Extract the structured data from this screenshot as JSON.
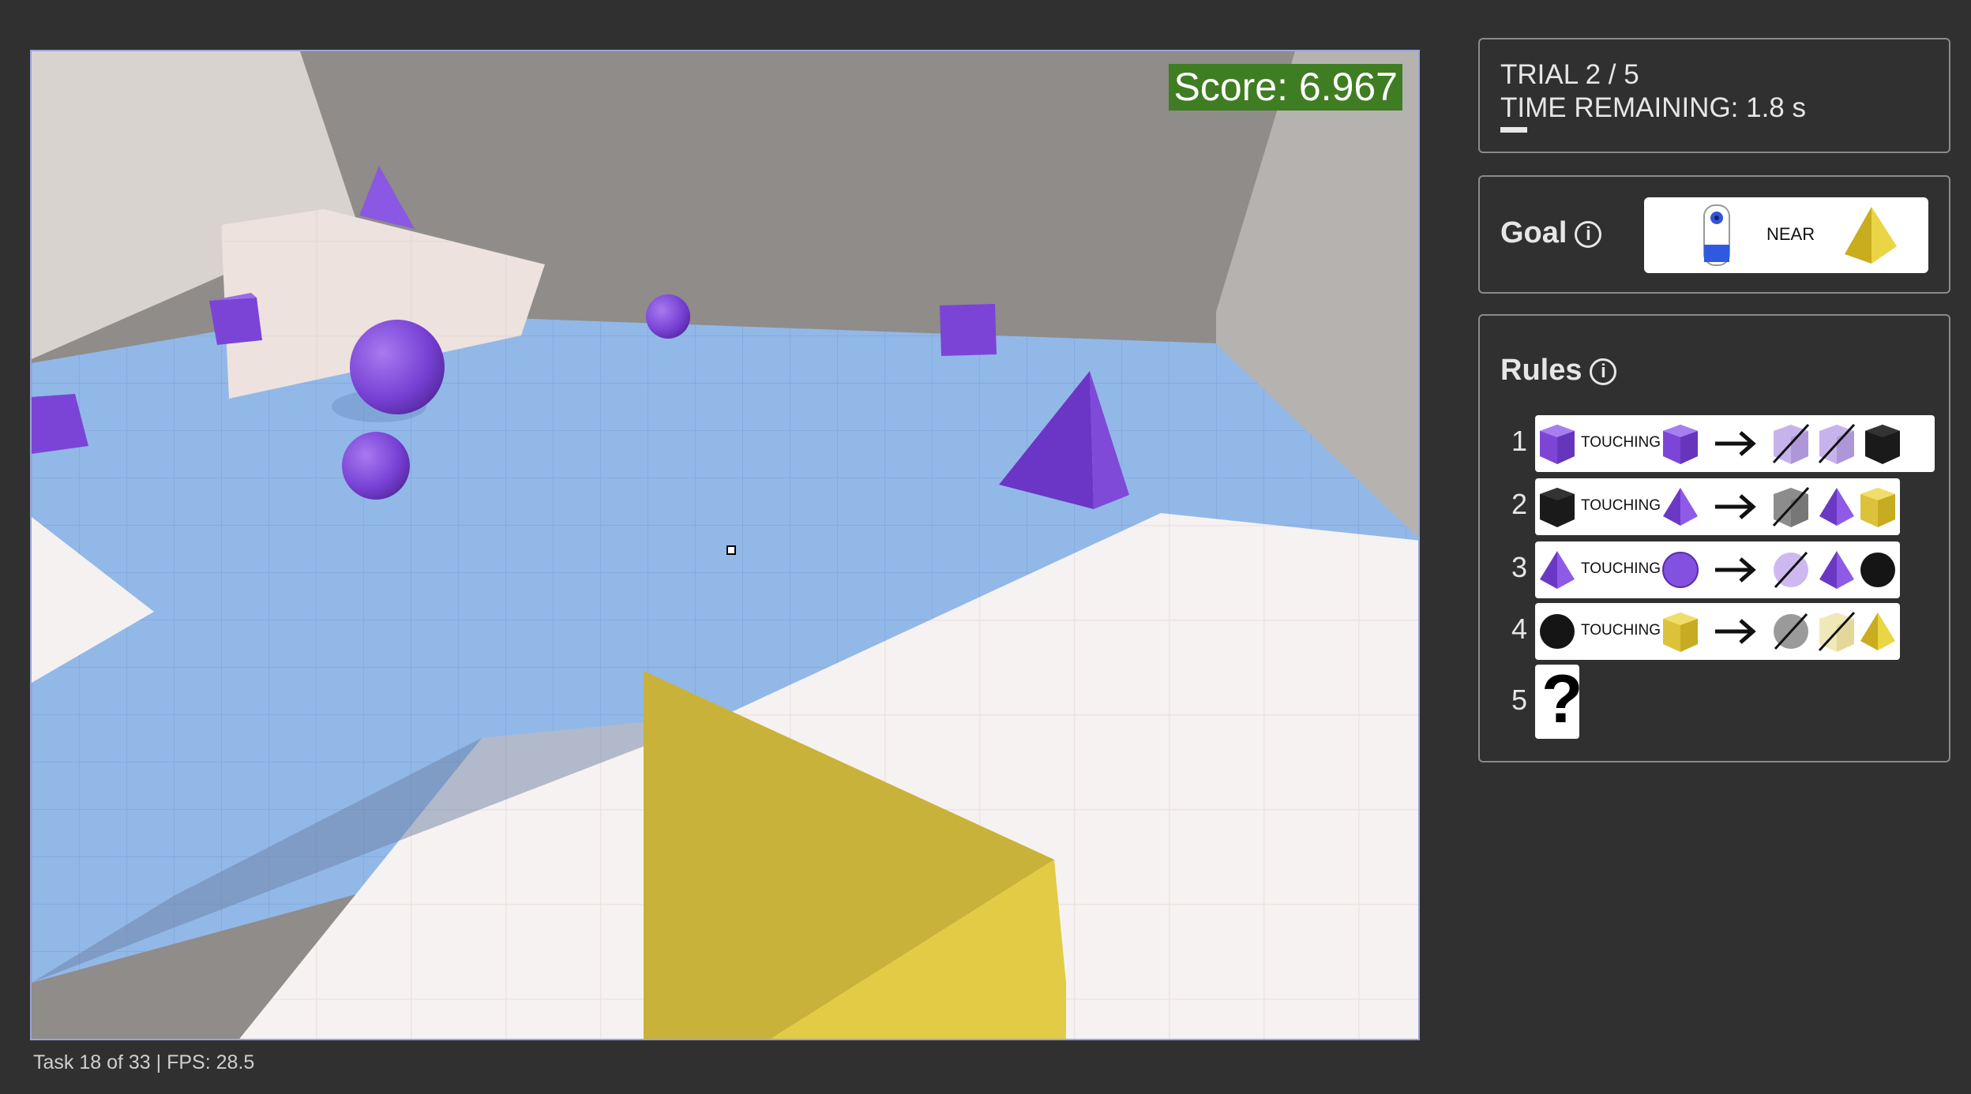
{
  "game": {
    "score_text": "Score: 6.967",
    "footer_text": "Task 18 of 33 | FPS: 28.5"
  },
  "trial": {
    "line1": "TRIAL 2 / 5",
    "line2": "TIME REMAINING: 1.8 s"
  },
  "goal": {
    "title": "Goal",
    "info_icon": "info-icon",
    "agent_icon": "agent-icon",
    "relation": "NEAR",
    "target_icon": "yellow-pyramid-icon"
  },
  "rules": {
    "title": "Rules",
    "items": [
      {
        "num": "1",
        "subject": "purple-cube",
        "relation": "TOUCHING",
        "object": "purple-cube",
        "results": [
          "purple-cube-removed",
          "purple-cube-removed",
          "black-cube"
        ]
      },
      {
        "num": "2",
        "subject": "black-cube",
        "relation": "TOUCHING",
        "object": "purple-pyramid",
        "results": [
          "black-cube-removed",
          "purple-pyramid",
          "yellow-cube"
        ]
      },
      {
        "num": "3",
        "subject": "purple-pyramid",
        "relation": "TOUCHING",
        "object": "purple-sphere",
        "results": [
          "purple-sphere-removed",
          "purple-pyramid",
          "black-sphere"
        ]
      },
      {
        "num": "4",
        "subject": "black-sphere",
        "relation": "TOUCHING",
        "object": "yellow-cube",
        "results": [
          "black-sphere-removed",
          "yellow-cube-removed",
          "yellow-pyramid"
        ]
      },
      {
        "num": "5",
        "unknown": "?"
      }
    ]
  },
  "colors": {
    "background": "#303030",
    "floor": "#92b8e8",
    "purple": "#7d45d8",
    "yellow": "#dcc73c",
    "score_bg": "#3f7d22"
  }
}
